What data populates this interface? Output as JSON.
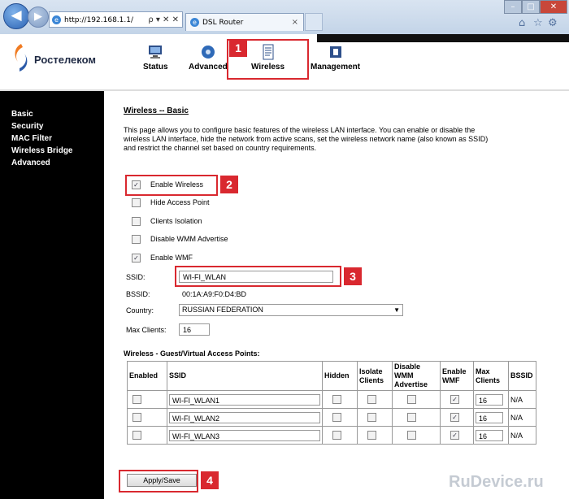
{
  "browser": {
    "address": "http://192.168.1.1/",
    "address_tools": "ρ ▾ ✕ ✕",
    "tab_title": "DSL Router",
    "tab_close": "×"
  },
  "brand": {
    "logo_text": "Ростелеком"
  },
  "top_menu": [
    {
      "label": "Status",
      "icon": "monitor-icon"
    },
    {
      "label": "Advanced",
      "icon": "gear-globe-icon"
    },
    {
      "label": "Wireless",
      "icon": "wireless-doc-icon"
    },
    {
      "label": "Management",
      "icon": "folder-icon"
    }
  ],
  "sidebar": {
    "items": [
      "Basic",
      "Security",
      "MAC Filter",
      "Wireless Bridge",
      "Advanced"
    ]
  },
  "page": {
    "title": "Wireless -- Basic",
    "description": "This page allows you to configure basic features of the wireless LAN interface. You can enable or disable the wireless LAN interface, hide the network from active scans, set the wireless network name (also known as SSID) and restrict the channel set based on country requirements.",
    "options": [
      {
        "label": "Enable Wireless",
        "checked": true
      },
      {
        "label": "Hide Access Point",
        "checked": false
      },
      {
        "label": "Clients Isolation",
        "checked": false
      },
      {
        "label": "Disable WMM Advertise",
        "checked": false
      },
      {
        "label": "Enable WMF",
        "checked": true
      }
    ],
    "ssid_label": "SSID:",
    "ssid_value": "WI-FI_WLAN",
    "bssid_label": "BSSID:",
    "bssid_value": "00:1A:A9:F0:D4:BD",
    "country_label": "Country:",
    "country_value": "RUSSIAN FEDERATION",
    "max_clients_label": "Max Clients:",
    "max_clients_value": "16"
  },
  "guest": {
    "title": "Wireless - Guest/Virtual Access Points:",
    "headers": [
      "Enabled",
      "SSID",
      "Hidden",
      "Isolate Clients",
      "Disable WMM Advertise",
      "Enable WMF",
      "Max Clients",
      "BSSID"
    ],
    "rows": [
      {
        "enabled": false,
        "ssid": "WI-FI_WLAN1",
        "hidden": false,
        "isolate": false,
        "disable_wmm": false,
        "enable_wmf": true,
        "max_clients": "16",
        "bssid": "N/A"
      },
      {
        "enabled": false,
        "ssid": "WI-FI_WLAN2",
        "hidden": false,
        "isolate": false,
        "disable_wmm": false,
        "enable_wmf": true,
        "max_clients": "16",
        "bssid": "N/A"
      },
      {
        "enabled": false,
        "ssid": "WI-FI_WLAN3",
        "hidden": false,
        "isolate": false,
        "disable_wmm": false,
        "enable_wmf": true,
        "max_clients": "16",
        "bssid": "N/A"
      }
    ]
  },
  "apply_label": "Apply/Save",
  "annotations": [
    "1",
    "2",
    "3",
    "4"
  ],
  "watermark": "RuDevice.ru",
  "colors": {
    "annotation_red": "#d9282f",
    "sidebar_bg": "#000000",
    "brand_orange": "#f07b22",
    "brand_blue": "#2b5aa8"
  }
}
